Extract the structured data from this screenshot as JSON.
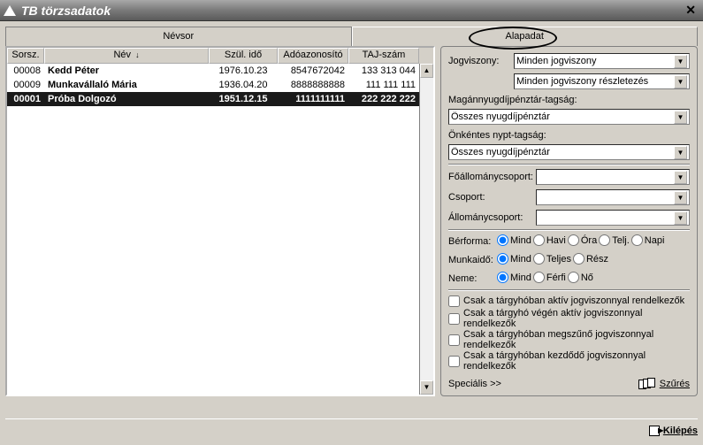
{
  "title": "TB törzsadatok",
  "tabs": {
    "left": "Névsor",
    "right": "Alapadat"
  },
  "columns": {
    "sorsz": "Sorsz.",
    "nev": "Név",
    "szul": "Szül. idő",
    "ado": "Adóazonosító",
    "taj": "TAJ-szám"
  },
  "rows": [
    {
      "sorsz": "00008",
      "nev": "Kedd Péter",
      "szul": "1976.10.23",
      "ado": "8547672042",
      "taj": "133 313 044",
      "selected": false
    },
    {
      "sorsz": "00009",
      "nev": "Munkavállaló Mária",
      "szul": "1936.04.20",
      "ado": "8888888888",
      "taj": "111 111 111",
      "selected": false
    },
    {
      "sorsz": "00001",
      "nev": "Próba Dolgozó",
      "szul": "1951.12.15",
      "ado": "1111111111",
      "taj": "222 222 222",
      "selected": true
    }
  ],
  "filters": {
    "jogviszony_label": "Jogviszony:",
    "jogviszony_value": "Minden jogviszony",
    "jogviszony2_value": "Minden jogviszony részletezés",
    "magan_label": "Magánnyugdíjpénztár-tagság:",
    "magan_value": "Összes nyugdíjpénztár",
    "onkentes_label": "Önkéntes nypt-tagság:",
    "onkentes_value": "Összes nyugdíjpénztár",
    "foallomany_label": "Főállománycsoport:",
    "foallomany_value": "",
    "csoport_label": "Csoport:",
    "csoport_value": "",
    "allomany_label": "Állománycsoport:",
    "allomany_value": "",
    "berforma_label": "Bérforma:",
    "munkaido_label": "Munkaidő:",
    "neme_label": "Neme:",
    "opts_berforma": [
      "Mind",
      "Havi",
      "Óra",
      "Telj.",
      "Napi"
    ],
    "opts_munkaido": [
      "Mind",
      "Teljes",
      "Rész"
    ],
    "opts_neme": [
      "Mind",
      "Férfi",
      "Nő"
    ],
    "checks": [
      "Csak a tárgyhóban aktív jogviszonnyal rendelkezők",
      "Csak a tárgyhó végén aktív jogviszonnyal rendelkezők",
      "Csak a tárgyhóban megszűnő jogviszonnyal rendelkezők",
      "Csak a tárgyhóban kezdődő jogviszonnyal rendelkezők"
    ],
    "specialis": "Speciális >>",
    "szures": "Szűrés"
  },
  "footer": {
    "exit": "Kilépés"
  }
}
